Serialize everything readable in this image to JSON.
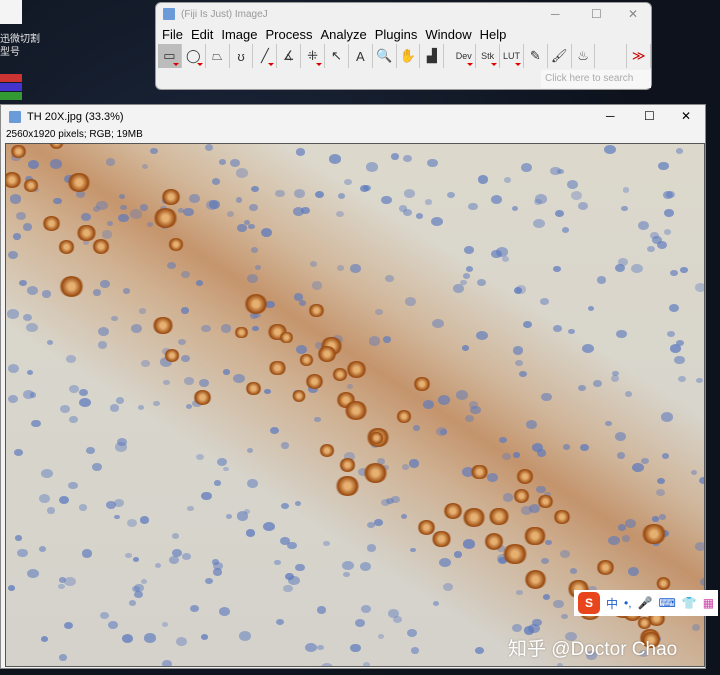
{
  "desktop": {
    "text_line1": "迅微切割",
    "text_line2": "型号"
  },
  "imagej": {
    "title": "(Fiji Is Just) ImageJ",
    "menu": [
      "File",
      "Edit",
      "Image",
      "Process",
      "Analyze",
      "Plugins",
      "Window",
      "Help"
    ],
    "tools": [
      {
        "name": "rectangle-tool",
        "glyph": "▭",
        "tri": true
      },
      {
        "name": "oval-tool",
        "glyph": "◯",
        "tri": true
      },
      {
        "name": "polygon-tool",
        "glyph": "⏢",
        "tri": false
      },
      {
        "name": "freehand-tool",
        "glyph": "ʊ",
        "tri": false
      },
      {
        "name": "line-tool",
        "glyph": "╱",
        "tri": true
      },
      {
        "name": "angle-tool",
        "glyph": "∡",
        "tri": false
      },
      {
        "name": "multipoint-tool",
        "glyph": "⁜",
        "tri": true
      },
      {
        "name": "wand-tool",
        "glyph": "↖",
        "tri": false
      },
      {
        "name": "text-tool",
        "glyph": "A",
        "tri": false
      },
      {
        "name": "magnifier-tool",
        "glyph": "🔍",
        "tri": false
      },
      {
        "name": "hand-tool",
        "glyph": "✋",
        "tri": false
      },
      {
        "name": "color-picker-tool",
        "glyph": "▟",
        "tri": false
      },
      {
        "name": "dev-menu",
        "glyph": "Dev",
        "tri": true
      },
      {
        "name": "stk-menu",
        "glyph": "Stk",
        "tri": true
      },
      {
        "name": "lut-menu",
        "glyph": "LUT",
        "tri": true
      },
      {
        "name": "pencil-tool",
        "glyph": "✎",
        "tri": false
      },
      {
        "name": "brush-tool",
        "glyph": "🖌",
        "tri": false
      },
      {
        "name": "flood-fill-tool",
        "glyph": "♨",
        "tri": false
      },
      {
        "name": "blank-tool",
        "glyph": "",
        "tri": false
      },
      {
        "name": "more-tools",
        "glyph": "≫",
        "tri": false
      }
    ],
    "search_placeholder": "Click here to search"
  },
  "image_window": {
    "title": "TH 20X.jpg (33.3%)",
    "info": "2560x1920 pixels; RGB; 19MB"
  },
  "ime": {
    "logo": "S",
    "mode": "中",
    "punct": "•,"
  },
  "watermark": "知乎 @Doctor Chao"
}
